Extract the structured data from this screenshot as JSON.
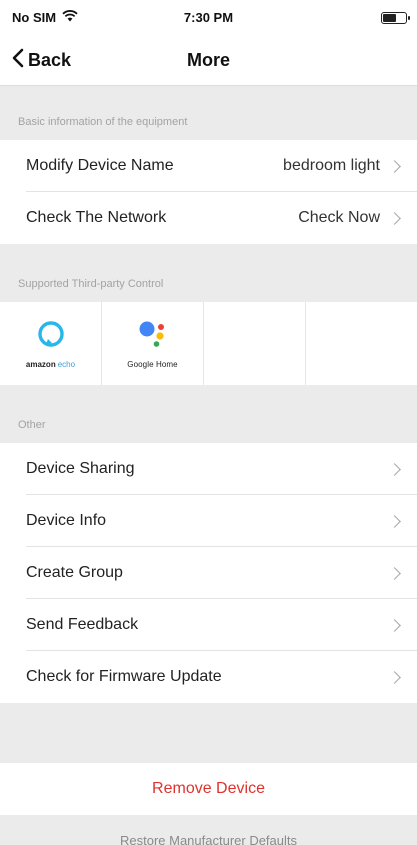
{
  "status_bar": {
    "carrier": "No SIM",
    "time": "7:30 PM",
    "battery_level": 0.6
  },
  "nav": {
    "back_label": "Back",
    "title": "More"
  },
  "sections": {
    "basic": {
      "header": "Basic information of the equipment",
      "items": [
        {
          "label": "Modify Device Name",
          "value": "bedroom light"
        },
        {
          "label": "Check The Network",
          "value": "Check Now"
        }
      ]
    },
    "third_party": {
      "header": "Supported Third-party Control",
      "items": [
        {
          "icon": "amazon-echo-icon",
          "brand": "amazon",
          "product": "echo"
        },
        {
          "icon": "google-assistant-icon",
          "label": "Google Home"
        }
      ]
    },
    "other": {
      "header": "Other",
      "items": [
        {
          "label": "Device Sharing"
        },
        {
          "label": "Device Info"
        },
        {
          "label": "Create Group"
        },
        {
          "label": "Send Feedback"
        },
        {
          "label": "Check for Firmware Update"
        }
      ]
    }
  },
  "actions": {
    "remove_label": "Remove Device",
    "restore_label": "Restore Manufacturer Defaults"
  },
  "colors": {
    "destructive": "#e0322d",
    "alexa_blue": "#29b6e8",
    "google_blue": "#4285f4",
    "google_red": "#ea4335",
    "google_yellow": "#fbbc05",
    "google_green": "#34a853"
  }
}
